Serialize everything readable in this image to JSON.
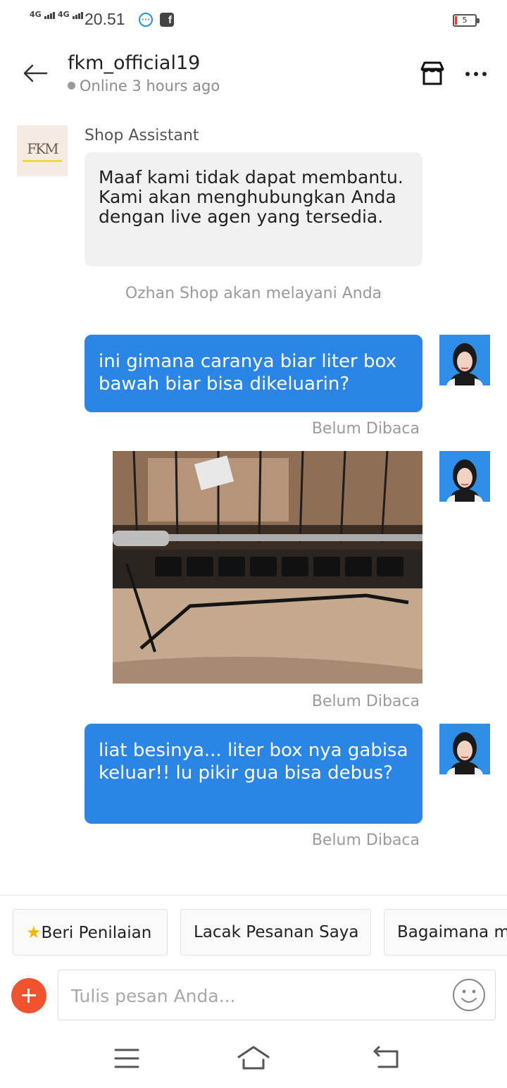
{
  "status_bar": {
    "signal1": "4G",
    "signal2": "4G",
    "time": "20.51",
    "battery_level": "5"
  },
  "header": {
    "shop_name": "fkm_official19",
    "online_status": "Online 3 hours ago",
    "icons": [
      "back-arrow-icon",
      "store-icon",
      "more-icon"
    ]
  },
  "shop_avatar": {
    "logo_text": "FKM"
  },
  "messages": {
    "assistant_label": "Shop Assistant",
    "assistant_text": "Maaf kami tidak dapat membantu. Kami akan menghubungkan Anda dengan live agen yang tersedia.",
    "system_text": "Ozhan Shop akan melayani Anda",
    "out1_text": "ini gimana caranya biar liter box bawah biar bisa dikeluarin?",
    "out1_status": "Belum Dibaca",
    "out2_status": "Belum Dibaca",
    "out3_text": "liat besinya... liter box nya gabisa keluar!! lu pikir gua bisa debus?",
    "out3_status": "Belum Dibaca"
  },
  "quick_replies": {
    "chip1": "Beri Penilaian",
    "chip2": "Lacak Pesanan Saya",
    "chip3": "Bagaimana m"
  },
  "composer": {
    "placeholder": "Tulis pesan Anda..."
  },
  "colors": {
    "outgoing_bubble": "#2b85e4",
    "incoming_bubble": "#f1f1f1",
    "plus_button": "#f0532d"
  }
}
